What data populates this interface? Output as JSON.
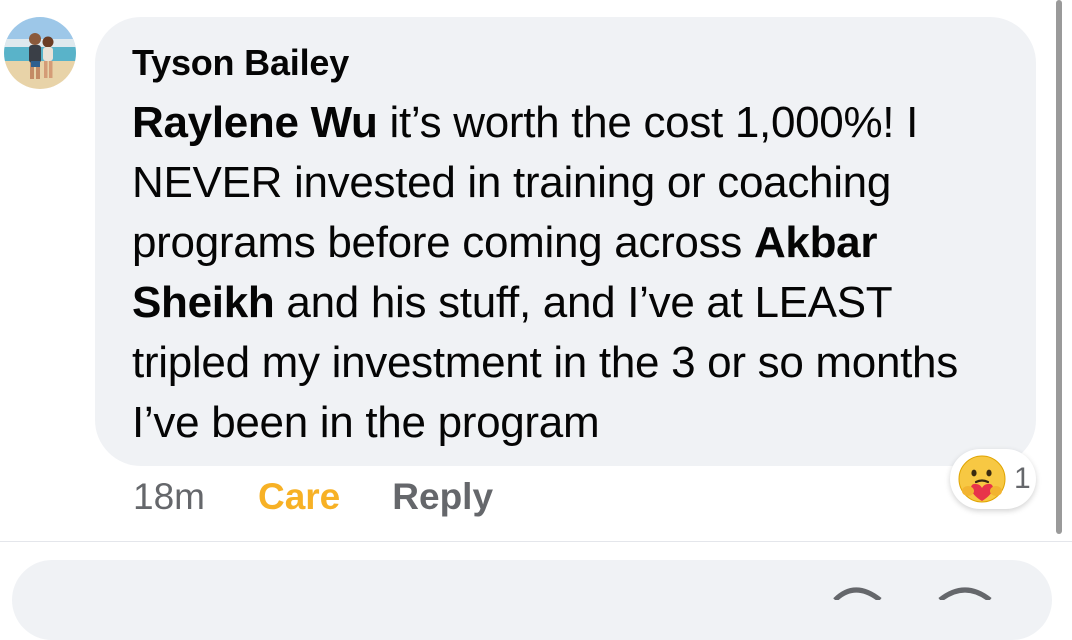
{
  "comment": {
    "author": "Tyson Bailey",
    "text_segments": [
      {
        "text": "Raylene Wu",
        "bold": true
      },
      {
        "text": " it’s worth the cost 1,000%! I NEVER invested in training or coaching programs before coming across ",
        "bold": false
      },
      {
        "text": "Akbar Sheikh",
        "bold": true
      },
      {
        "text": " and his stuff, and I’ve at LEAST tripled my investment in the 3 or so months I’ve been in the program",
        "bold": false
      }
    ],
    "timestamp": "18m",
    "reaction_label": "Care",
    "reply_label": "Reply",
    "reaction_count": "1",
    "reaction_icon": "care-emoji-icon"
  },
  "colors": {
    "bubble": "#f0f2f5",
    "care": "#f7b125",
    "muted": "#65676b"
  }
}
